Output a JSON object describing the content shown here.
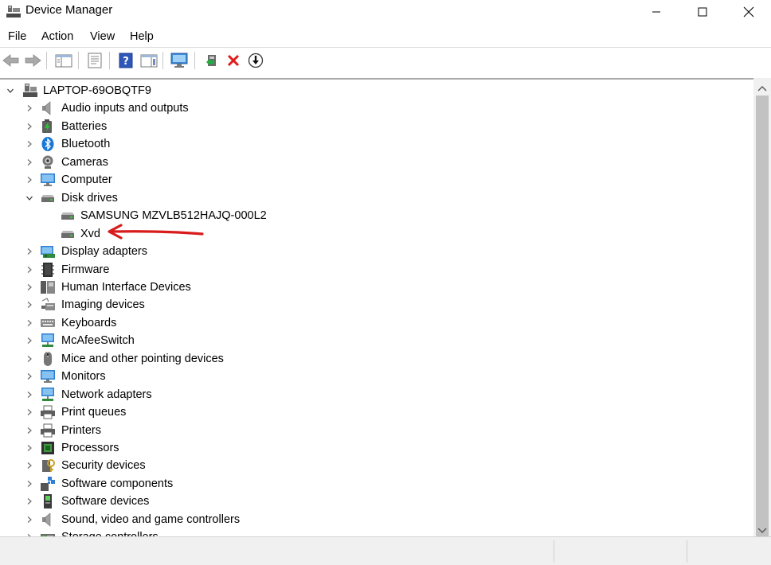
{
  "window": {
    "title": "Device Manager",
    "controls": {
      "minimize": "minimize",
      "maximize": "maximize",
      "close": "close"
    }
  },
  "menu": [
    "File",
    "Action",
    "View",
    "Help"
  ],
  "toolbar": {
    "buttons": [
      "back-arrow-icon",
      "forward-arrow-icon",
      "show-hide-console-tree-icon",
      "properties-icon",
      "help-icon",
      "action-pane-icon",
      "scan-hardware-icon",
      "update-driver-icon",
      "uninstall-device-icon",
      "disable-device-icon"
    ]
  },
  "tree": {
    "root": "LAPTOP-69OBQTF9",
    "categories": [
      {
        "label": "Audio inputs and outputs",
        "icon": "speaker-icon"
      },
      {
        "label": "Batteries",
        "icon": "battery-icon"
      },
      {
        "label": "Bluetooth",
        "icon": "bluetooth-icon"
      },
      {
        "label": "Cameras",
        "icon": "camera-icon"
      },
      {
        "label": "Computer",
        "icon": "monitor-icon"
      },
      {
        "label": "Disk drives",
        "icon": "disk-drive-icon",
        "expanded": true,
        "children": [
          {
            "label": "SAMSUNG MZVLB512HAJQ-000L2",
            "icon": "disk-drive-icon"
          },
          {
            "label": "Xvd",
            "icon": "disk-drive-icon"
          }
        ]
      },
      {
        "label": "Display adapters",
        "icon": "display-adapter-icon"
      },
      {
        "label": "Firmware",
        "icon": "chip-icon"
      },
      {
        "label": "Human Interface Devices",
        "icon": "hid-icon"
      },
      {
        "label": "Imaging devices",
        "icon": "scanner-icon"
      },
      {
        "label": "Keyboards",
        "icon": "keyboard-icon"
      },
      {
        "label": "McAfeeSwitch",
        "icon": "network-icon"
      },
      {
        "label": "Mice and other pointing devices",
        "icon": "mouse-icon"
      },
      {
        "label": "Monitors",
        "icon": "monitor-icon"
      },
      {
        "label": "Network adapters",
        "icon": "network-icon"
      },
      {
        "label": "Print queues",
        "icon": "printer-icon"
      },
      {
        "label": "Printers",
        "icon": "printer-icon"
      },
      {
        "label": "Processors",
        "icon": "processor-icon"
      },
      {
        "label": "Security devices",
        "icon": "security-icon"
      },
      {
        "label": "Software components",
        "icon": "software-component-icon"
      },
      {
        "label": "Software devices",
        "icon": "software-device-icon"
      },
      {
        "label": "Sound, video and game controllers",
        "icon": "speaker-icon"
      },
      {
        "label": "Storage controllers",
        "icon": "storage-controller-icon"
      }
    ]
  },
  "annotation": {
    "color": "#d81b1b",
    "target": "Xvd"
  },
  "colors": {
    "accent": "#0078d7",
    "annotation": "#d81b1b"
  }
}
